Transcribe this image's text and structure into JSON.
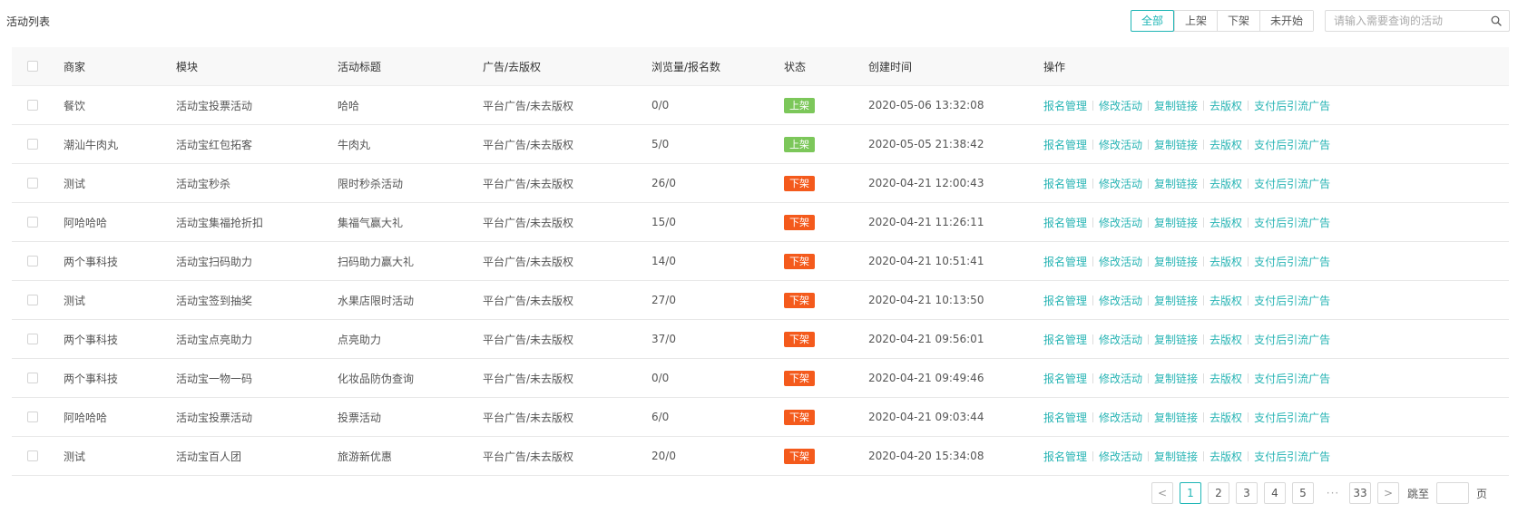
{
  "page_title": "活动列表",
  "filters": [
    {
      "label": "全部",
      "active": true
    },
    {
      "label": "上架",
      "active": false
    },
    {
      "label": "下架",
      "active": false
    },
    {
      "label": "未开始",
      "active": false
    }
  ],
  "search": {
    "placeholder": "请输入需要查询的活动",
    "value": "",
    "icon": "search-icon"
  },
  "table": {
    "headers": {
      "merchant": "商家",
      "module": "模块",
      "title": "活动标题",
      "ad": "广告/去版权",
      "views": "浏览量/报名数",
      "status": "状态",
      "created": "创建时间",
      "ops": "操作"
    },
    "ops": [
      "报名管理",
      "修改活动",
      "复制链接",
      "去版权",
      "支付后引流广告"
    ],
    "status_colors": {
      "上架": "#7cc75a",
      "下架": "#f45a1c"
    },
    "rows": [
      {
        "merchant": "餐饮",
        "module": "活动宝投票活动",
        "title": "哈哈",
        "ad": "平台广告/未去版权",
        "views": "0/0",
        "status": "上架",
        "created": "2020-05-06 13:32:08"
      },
      {
        "merchant": "潮汕牛肉丸",
        "module": "活动宝红包拓客",
        "title": "牛肉丸",
        "ad": "平台广告/未去版权",
        "views": "5/0",
        "status": "上架",
        "created": "2020-05-05 21:38:42"
      },
      {
        "merchant": "测试",
        "module": "活动宝秒杀",
        "title": "限时秒杀活动",
        "ad": "平台广告/未去版权",
        "views": "26/0",
        "status": "下架",
        "created": "2020-04-21 12:00:43"
      },
      {
        "merchant": "阿哈哈哈",
        "module": "活动宝集福抢折扣",
        "title": "集福气赢大礼",
        "ad": "平台广告/未去版权",
        "views": "15/0",
        "status": "下架",
        "created": "2020-04-21 11:26:11"
      },
      {
        "merchant": "两个事科技",
        "module": "活动宝扫码助力",
        "title": "扫码助力赢大礼",
        "ad": "平台广告/未去版权",
        "views": "14/0",
        "status": "下架",
        "created": "2020-04-21 10:51:41"
      },
      {
        "merchant": "测试",
        "module": "活动宝签到抽奖",
        "title": "水果店限时活动",
        "ad": "平台广告/未去版权",
        "views": "27/0",
        "status": "下架",
        "created": "2020-04-21 10:13:50"
      },
      {
        "merchant": "两个事科技",
        "module": "活动宝点亮助力",
        "title": "点亮助力",
        "ad": "平台广告/未去版权",
        "views": "37/0",
        "status": "下架",
        "created": "2020-04-21 09:56:01"
      },
      {
        "merchant": "两个事科技",
        "module": "活动宝一物一码",
        "title": "化妆品防伪查询",
        "ad": "平台广告/未去版权",
        "views": "0/0",
        "status": "下架",
        "created": "2020-04-21 09:49:46"
      },
      {
        "merchant": "阿哈哈哈",
        "module": "活动宝投票活动",
        "title": "投票活动",
        "ad": "平台广告/未去版权",
        "views": "6/0",
        "status": "下架",
        "created": "2020-04-21 09:03:44"
      },
      {
        "merchant": "测试",
        "module": "活动宝百人团",
        "title": "旅游新优惠",
        "ad": "平台广告/未去版权",
        "views": "20/0",
        "status": "下架",
        "created": "2020-04-20 15:34:08"
      }
    ]
  },
  "pagination": {
    "prev": "<",
    "pages": [
      "1",
      "2",
      "3",
      "4",
      "5"
    ],
    "current": "1",
    "ellipsis": "···",
    "last": "33",
    "next": ">",
    "jump_label": "跳至",
    "jump_unit": "页"
  }
}
